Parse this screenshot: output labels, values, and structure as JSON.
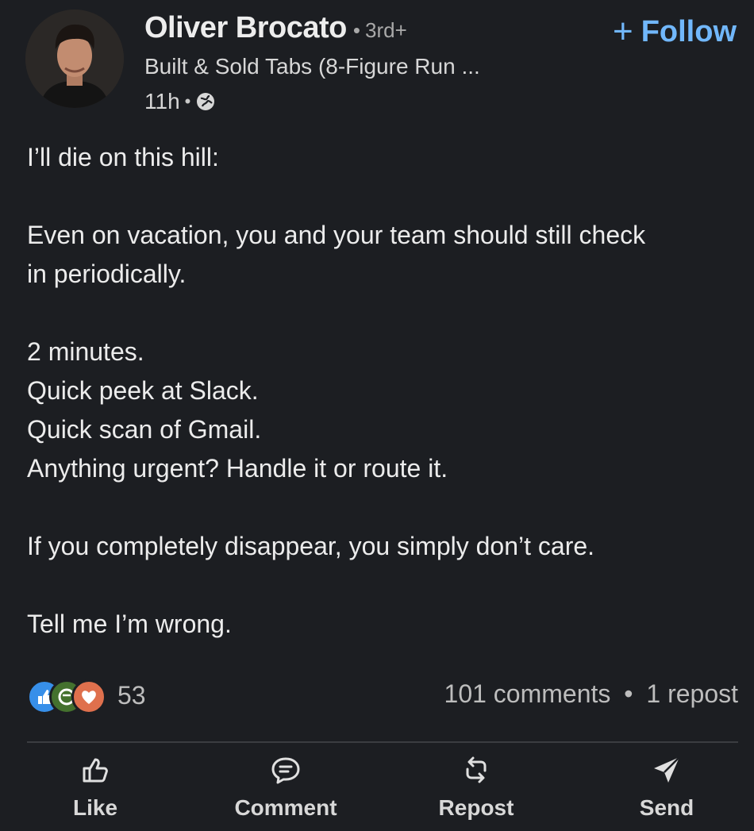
{
  "post": {
    "author": {
      "name": "Oliver Brocato",
      "degree": "3rd+",
      "headline": "Built & Sold Tabs (8-Figure Run ...",
      "time": "11h"
    },
    "follow_label": "Follow",
    "body": {
      "line1": "I’ll die on this hill:",
      "line2": "Even on vacation, you and your team should still check",
      "line3": "in periodically.",
      "line4": "2 minutes.",
      "line5": "Quick peek at Slack.",
      "line6": "Quick scan of Gmail.",
      "line7": "Anything urgent? Handle it or route it.",
      "line8": "If you completely disappear, you simply don’t care.",
      "line9": "Tell me I’m wrong."
    },
    "social": {
      "reactions_count": "53",
      "comments": "101 comments",
      "reposts": "1 repost"
    },
    "actions": {
      "like": "Like",
      "comment": "Comment",
      "repost": "Repost",
      "send": "Send"
    }
  },
  "icons": {
    "follow": "plus-icon",
    "visibility": "globe-icon",
    "reactions": [
      "like-reaction-icon",
      "celebrate-reaction-icon",
      "love-reaction-icon"
    ],
    "actions": [
      "thumbs-up-icon",
      "comment-icon",
      "repost-icon",
      "send-icon"
    ]
  },
  "colors": {
    "background": "#1c1e22",
    "accent": "#71b7fb",
    "like": "#378fe9",
    "celebrate": "#44712e",
    "love": "#df704d"
  }
}
